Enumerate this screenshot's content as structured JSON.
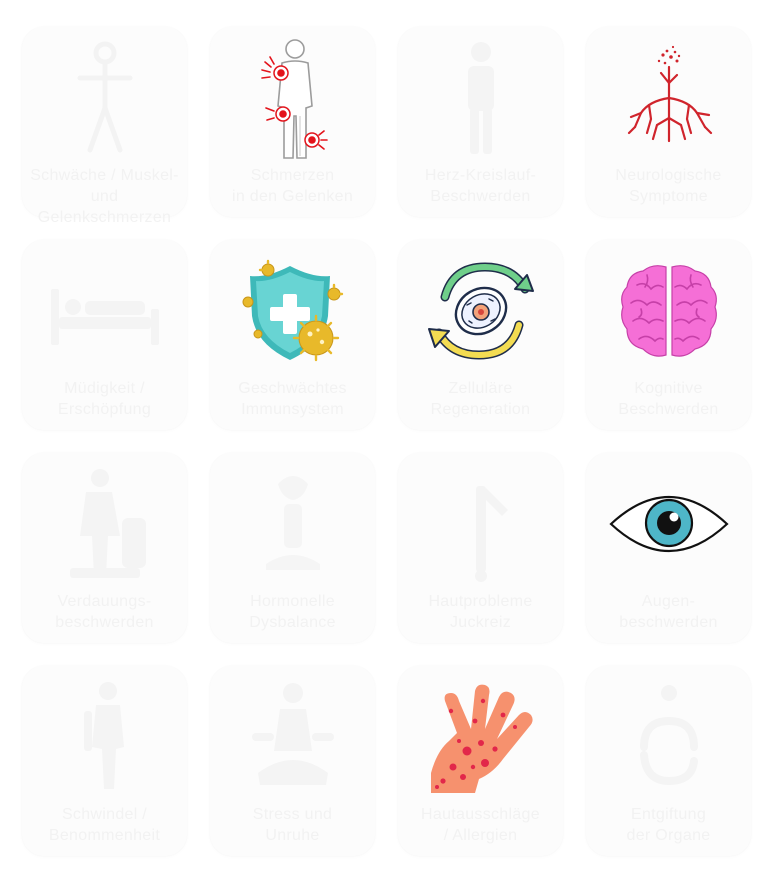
{
  "cards": [
    {
      "name": "card-1",
      "icon": "skeleton-figure-icon",
      "line1": "Schwäche / Muskel-",
      "line2": "und Gelenkschmerzen"
    },
    {
      "name": "card-2",
      "icon": "joint-pain-body-icon",
      "line1": "Schmerzen",
      "line2": "in den Gelenken"
    },
    {
      "name": "card-3",
      "icon": "standing-figure-icon",
      "line1": "Herz-Kreislauf-",
      "line2": "Beschwerden"
    },
    {
      "name": "card-4",
      "icon": "nerve-branches-icon",
      "line1": "Neurologische",
      "line2": "Symptome"
    },
    {
      "name": "card-5",
      "icon": "bed-icon",
      "line1": "Müdigkeit /",
      "line2": "Erschöpfung"
    },
    {
      "name": "card-6",
      "icon": "immune-shield-icon",
      "line1": "Geschwächtes",
      "line2": "Immunsystem"
    },
    {
      "name": "card-7",
      "icon": "cell-cycle-icon",
      "line1": "Zelluläre",
      "line2": "Regeneration"
    },
    {
      "name": "card-8",
      "icon": "brain-icon",
      "line1": "Kognitive",
      "line2": "Beschwerden"
    },
    {
      "name": "card-9",
      "icon": "digestion-figure-icon",
      "line1": "Verdauungs-",
      "line2": "beschwerden"
    },
    {
      "name": "card-10",
      "icon": "abstract-figure-icon",
      "line1": "Hormonelle",
      "line2": "Dysbalance"
    },
    {
      "name": "card-11",
      "icon": "needle-figure-icon",
      "line1": "Hautprobleme",
      "line2": "Juckreiz"
    },
    {
      "name": "card-12",
      "icon": "eye-icon",
      "line1": "Augen-",
      "line2": "beschwerden"
    },
    {
      "name": "card-13",
      "icon": "standing-person-icon",
      "line1": "Schwindel /",
      "line2": "Benommenheit"
    },
    {
      "name": "card-14",
      "icon": "meditation-figure-icon",
      "line1": "Stress und",
      "line2": "Unruhe"
    },
    {
      "name": "card-15",
      "icon": "skin-rash-hand-icon",
      "line1": "Hautausschläge",
      "line2": "/ Allergien"
    },
    {
      "name": "card-16",
      "icon": "recycle-figure-icon",
      "line1": "Entgiftung",
      "line2": "der Organe"
    }
  ],
  "colors": {
    "card_bg": "#fcfcfc",
    "faint_label": "#f2f2f2",
    "pain_red": "#e3131b",
    "shield_teal": "#4fc9c9",
    "virus_yellow": "#e8b92a",
    "brain_pink": "#f46dd2",
    "eye_blue": "#4eb6c8",
    "rash_skin": "#f6916e"
  }
}
